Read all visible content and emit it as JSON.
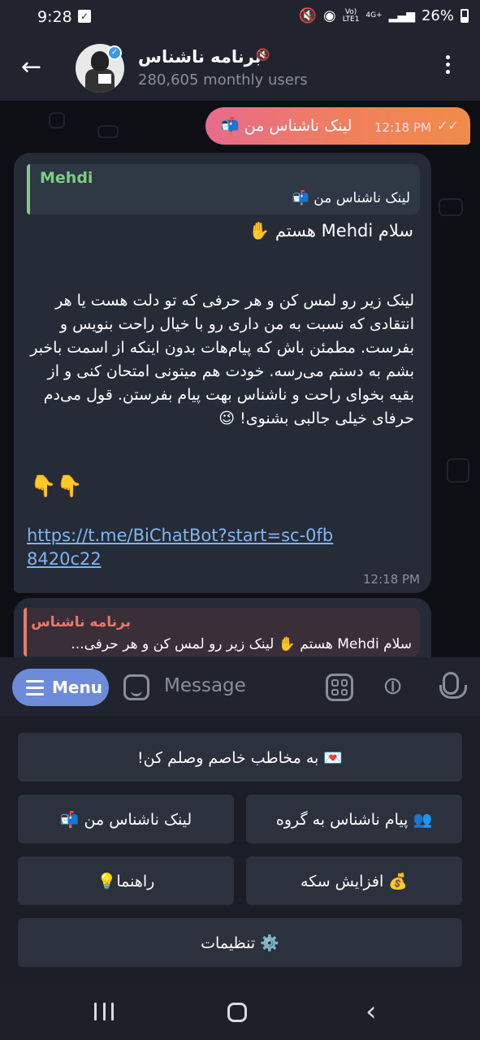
{
  "status_bar": {
    "time": "9:28",
    "net_top": "Vo)",
    "net_bottom": "LTE1",
    "net_4g": "4G+",
    "battery": "26%"
  },
  "header": {
    "title": "برنامه ناشناس",
    "subtitle": "280,605 monthly users"
  },
  "messages": {
    "outgoing": {
      "text": "لینک ناشناس من 📬",
      "time": "12:18 PM"
    },
    "incoming": {
      "reply_name": "Mehdi",
      "reply_text": "لینک ناشناس من 📬",
      "greeting": "سلام Mehdi هستم ✋",
      "body": "لینک زیر رو لمس کن و هر حرفی که تو دلت هست یا هر انتقادی که نسبت به من داری رو با خیال راحت بنویس و بفرست. مطمئن باش که پیام‌هات بدون اینکه از اسمت باخبر بشم به دستم می‌رسه. خودت هم میتونی امتحان کنی و از بقیه بخوای راحت و ناشناس بهت پیام بفرستن. قول می‌دم حرفای خیلی جالبی بشنوی! 😉",
      "pointers": "👇👇",
      "link": "https://t.me/BiChatBot?start=sc-0fb8420c22",
      "time": "12:18 PM"
    },
    "incoming2": {
      "reply_name": "برنامه ناشناس",
      "reply_text": "سلام Mehdi هستم ✋  لینک زیر رو لمس کن و هر حرفی..."
    }
  },
  "composer": {
    "menu_label": "Menu",
    "placeholder": "Message"
  },
  "keyboard": {
    "connect": "💌 به مخاطب خاصم وصلم کن!",
    "group": "👥 پیام ناشناس به گروه",
    "my_link": "لینک ناشناس من 📬",
    "coins": "💰 افزایش سکه",
    "help": "راهنما💡",
    "settings": "⚙️ تنظیمات"
  },
  "colors": {
    "accent": "#6d8bd8",
    "reply_green": "#7ccf7f",
    "reply_red": "#e9786f",
    "link": "#7fb5f0"
  }
}
